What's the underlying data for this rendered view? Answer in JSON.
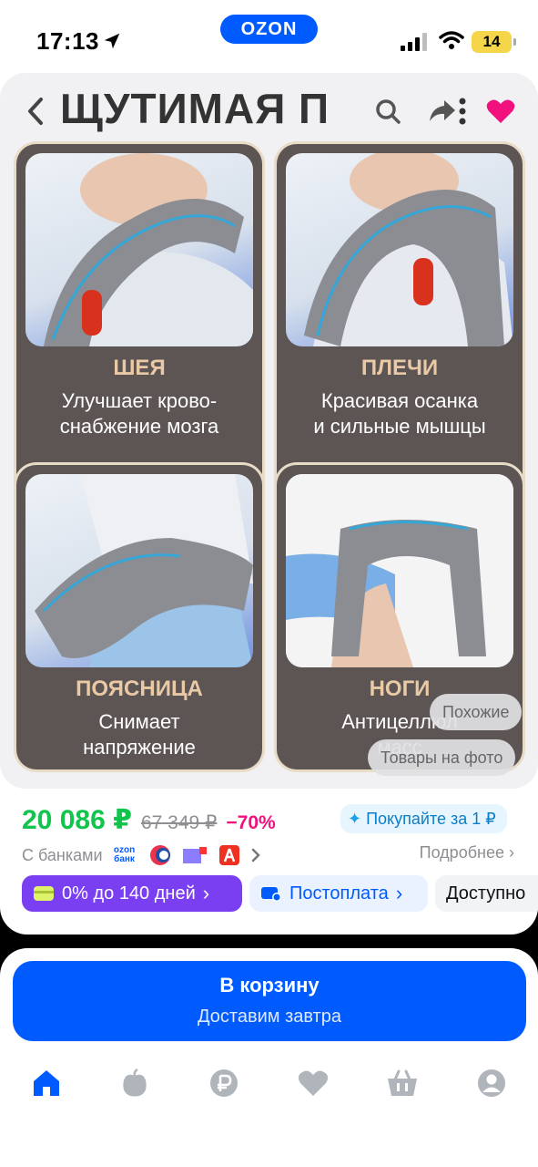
{
  "status_bar": {
    "time": "17:13",
    "brand": "OZON",
    "battery": "14"
  },
  "gallery": {
    "banner_title": "ЩУТИМАЯ П",
    "tiles": [
      {
        "title": "ШЕЯ",
        "line1": "Улучшает крово-",
        "line2": "снабжение мозга"
      },
      {
        "title": "ПЛЕЧИ",
        "line1": "Красивая осанка",
        "line2": "и сильные мышцы"
      },
      {
        "title": "ПОЯСНИЦА",
        "line1": "Снимает",
        "line2": "напряжение"
      },
      {
        "title": "НОГИ",
        "line1": "Антицеллюл",
        "line2": "масс"
      }
    ],
    "similar_chip": "Похожие",
    "photo_items_chip": "Товары на фото"
  },
  "product": {
    "price": "20 086 ₽",
    "old_price": "67 349 ₽",
    "discount": "−70%",
    "buy_for": "Покупайте за 1 ₽",
    "banks_label": "С банками",
    "ozon_bank_line1": "ozon",
    "ozon_bank_line2": "банк",
    "details_link": "Подробнее"
  },
  "chips": {
    "installment": "0% до 140 дней",
    "postpay": "Постоплата",
    "available": "Доступно"
  },
  "cart": {
    "title": "В корзину",
    "subtitle": "Доставим завтра"
  },
  "colors": {
    "brand": "#005bff",
    "price_green": "#10c44c",
    "discount_pink": "#f1117e",
    "installment_purple": "#7b3ff2",
    "heart_pink": "#f1117e",
    "tile_bg": "#5c5553"
  }
}
